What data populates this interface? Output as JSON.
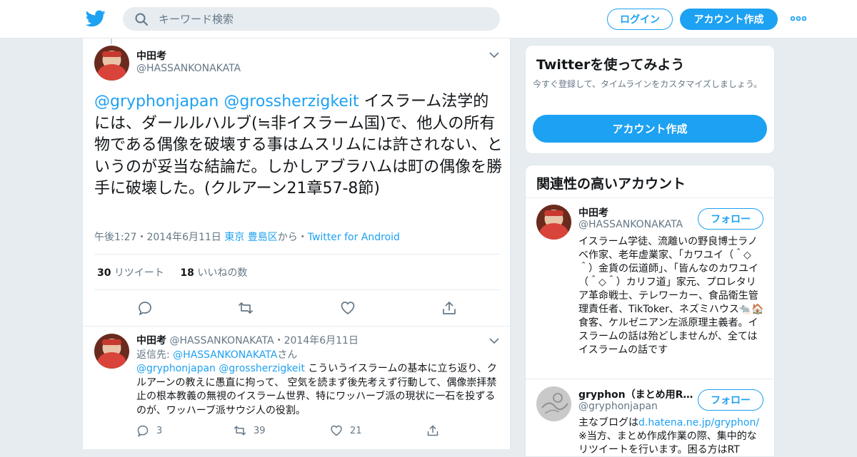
{
  "header": {
    "search_placeholder": "キーワード検索",
    "login_label": "ログイン",
    "signup_label": "アカウント作成",
    "accent": "#1da1f2"
  },
  "tweet": {
    "author_name": "中田考",
    "author_handle": "@HASSANKONAKATA",
    "mentions": [
      "@gryphonjapan",
      "@grossherzigkeit"
    ],
    "text": "イスラーム法学的には、ダールルハルブ(≒非イスラーム国)で、他人の所有物である偶像を破壊する事はムスリムには許されない、というのが妥当な結論だ。しかしアブラハムは町の偶像を勝手に破壊した。(クルアーン21章57-8節)",
    "time": "午後1:27",
    "date": "2014年6月11日",
    "location": "東京 豊島区",
    "location_suffix": "から",
    "source": "Twitter for Android",
    "retweets_count": "30",
    "retweets_label": "リツイート",
    "likes_count": "18",
    "likes_label": "いいねの数"
  },
  "reply": {
    "author_name": "中田考",
    "author_handle": "@HASSANKONAKATA",
    "date": "2014年6月11日",
    "reply_to_label": "返信先:",
    "reply_to_handle": "@HASSANKONAKATA",
    "reply_to_suffix": "さん",
    "mentions": [
      "@gryphonjapan",
      "@grossherzigkeit"
    ],
    "text": "こういうイスラームの基本に立ち返り、クルアーンの教えに愚直に拘って、 空気を読まず後先考えず行動して、偶像崇拝禁止の根本教義の無視のイスラーム世界、特にワッハーブ派の現状に一石を投ずるのが、ワッハーブ派サウジ人の役割。",
    "replies": "3",
    "retweets": "39",
    "likes": "21"
  },
  "signup_card": {
    "title": "Twitterを使ってみよう",
    "subtitle": "今すぐ登録して、タイムラインをカスタマイズしましょう。",
    "button": "アカウント作成"
  },
  "related": {
    "title": "関連性の高いアカウント",
    "follow_label": "フォロー",
    "accounts": [
      {
        "name": "中田考",
        "handle": "@HASSANKONAKATA",
        "bio": "イスラーム学徒、流離いの野良博士ラノベ作家、老年虚業家、「カワユイ（＾◇＾）金貨の伝道師」、「皆んなのカワユイ（＾◇＾）カリフ道」家元、プロレタリア革命戦士、テレワーカー、食品衛生管理責任者、TikToker、ネズミハウス🐀🏠食客、ケルゼニアン左派原理主義者。イスラームの話は殆どしませんが、全てはイスラームの話です"
      },
      {
        "name": "gryphon（まとめ用R…",
        "handle": "@gryphonjapan",
        "bio_prefix": "主なブログは",
        "bio_link": "d.hatena.ne.jp/gryphon/",
        "bio_rest": "※当方、まとめ作成作業の際、集中的なリツイートを行います。困る方はRT"
      }
    ]
  }
}
